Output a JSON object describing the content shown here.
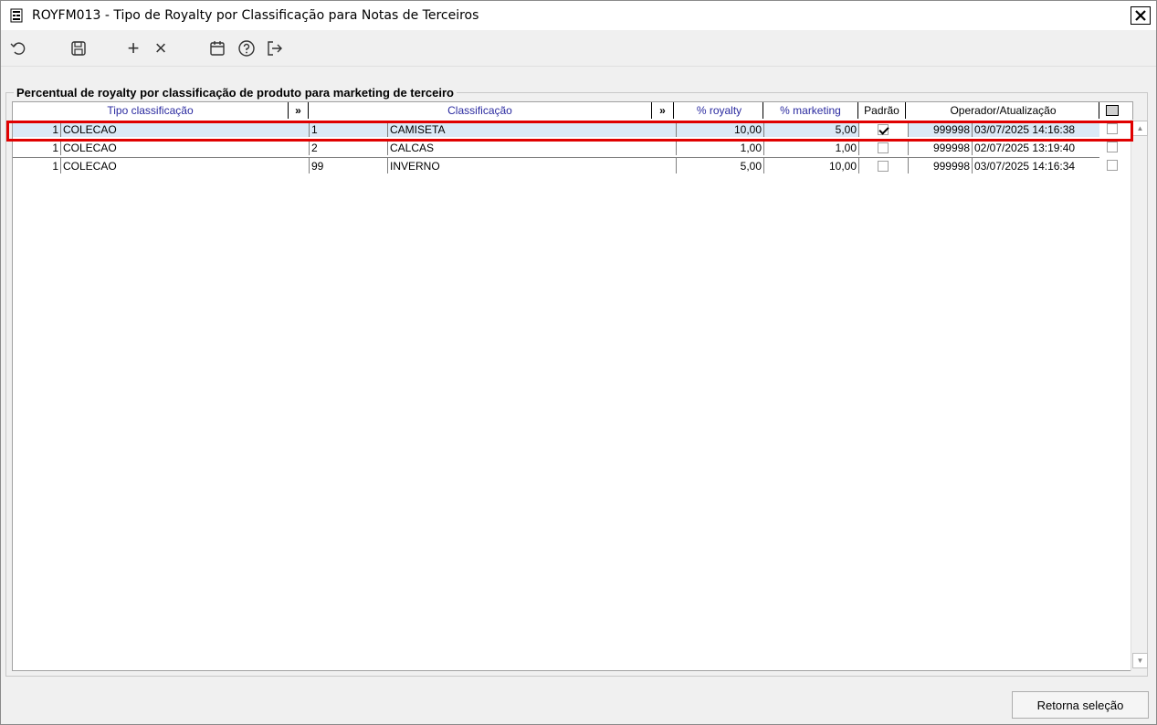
{
  "window": {
    "title": "ROYFM013 - Tipo de Royalty por Classificação para Notas de Terceiros",
    "close_label": "✕"
  },
  "toolbar": {
    "icons": [
      "undo-icon",
      "save-icon",
      "add-icon",
      "delete-icon",
      "calendar-icon",
      "help-icon",
      "exit-icon"
    ],
    "add_glyph": "+",
    "delete_glyph": "×"
  },
  "group": {
    "label": "Percentual de royalty por classificação de produto para marketing de terceiro"
  },
  "grid": {
    "headers": {
      "tipo": "Tipo classificação",
      "tipo_arrow": "»",
      "classificacao": "Classificação",
      "class_arrow": "»",
      "royalty": "% royalty",
      "marketing": "% marketing",
      "padrao": "Padrão",
      "operador": "Operador/Atualização"
    },
    "rows": [
      {
        "tipo_code": "1",
        "tipo_name": "COLECAO",
        "class_code": "1",
        "class_name": "CAMISETA",
        "royalty": "10,00",
        "marketing": "5,00",
        "padrao": true,
        "operador": "999998",
        "atualizacao": "03/07/2025 14:16:38",
        "selected_row": false,
        "highlighted": true
      },
      {
        "tipo_code": "1",
        "tipo_name": "COLECAO",
        "class_code": "2",
        "class_name": "CALCAS",
        "royalty": "1,00",
        "marketing": "1,00",
        "padrao": false,
        "operador": "999998",
        "atualizacao": "02/07/2025 13:19:40",
        "selected_row": false,
        "highlighted": false
      },
      {
        "tipo_code": "1",
        "tipo_name": "COLECAO",
        "class_code": "99",
        "class_name": "INVERNO",
        "royalty": "5,00",
        "marketing": "10,00",
        "padrao": false,
        "operador": "999998",
        "atualizacao": "03/07/2025 14:16:34",
        "selected_row": false,
        "highlighted": false
      }
    ]
  },
  "buttons": {
    "retorna": "Retorna seleção"
  },
  "colors": {
    "highlight": "#e00000",
    "header_text": "#2a2aa0",
    "selected_row_bg": "#dbe9f6"
  }
}
